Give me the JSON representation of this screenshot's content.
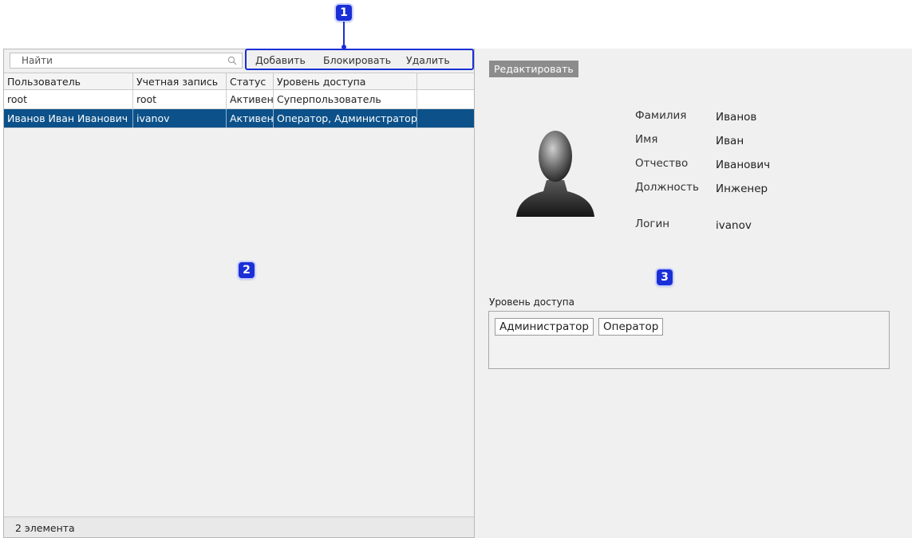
{
  "search": {
    "placeholder": "Найти"
  },
  "toolbar": {
    "add_label": "Добавить",
    "block_label": "Блокировать",
    "delete_label": "Удалить"
  },
  "table": {
    "columns": [
      "Пользователь",
      "Учетная запись",
      "Статус",
      "Уровень доступа",
      ""
    ],
    "rows": [
      {
        "user": "root",
        "account": "root",
        "status": "Активен",
        "access": "Суперпользователь",
        "selected": false
      },
      {
        "user": "Иванов Иван Иванович",
        "account": "ivanov",
        "status": "Активен",
        "access": "Оператор, Администратор",
        "selected": true
      }
    ]
  },
  "status_bar": {
    "count_text": "2 элемента"
  },
  "details": {
    "edit_label": "Редактировать",
    "fields": [
      {
        "label": "Фамилия",
        "value": "Иванов"
      },
      {
        "label": "Имя",
        "value": "Иван"
      },
      {
        "label": "Отчество",
        "value": "Иванович"
      },
      {
        "label": "Должность",
        "value": "Инженер"
      },
      {
        "label": "Логин",
        "value": "ivanov"
      }
    ],
    "access_title": "Уровень доступа",
    "roles": [
      "Администратор",
      "Оператор"
    ]
  },
  "markers": [
    "1",
    "2",
    "3"
  ],
  "colors": {
    "selected_row": "#0c5189",
    "marker": "#1a2fd6",
    "edit_button": "#8c8c8c"
  }
}
